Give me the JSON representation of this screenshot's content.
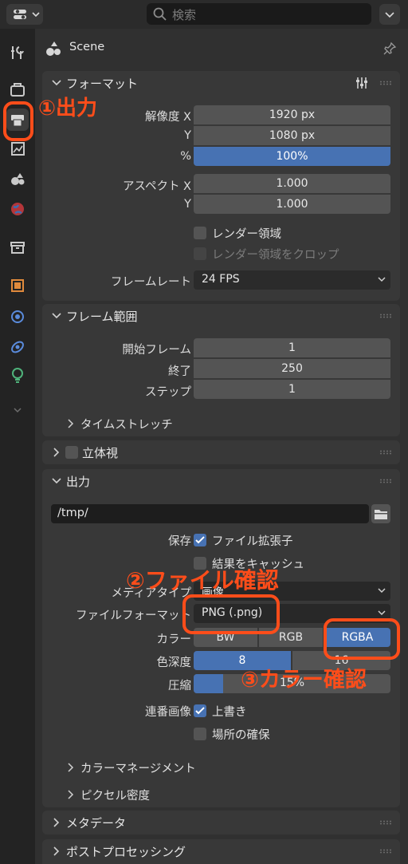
{
  "topbar": {
    "search_placeholder": "検索"
  },
  "scene": {
    "label": "Scene"
  },
  "format_panel": {
    "title": "フォーマット",
    "resolution_x_label": "解像度 X",
    "resolution_x": "1920 px",
    "resolution_y_label": "Y",
    "resolution_y": "1080 px",
    "percent_label": "%",
    "percent": "100%",
    "percent_fraction": 1.0,
    "aspect_x_label": "アスペクト X",
    "aspect_x": "1.000",
    "aspect_y_label": "Y",
    "aspect_y": "1.000",
    "render_region": "レンダー領域",
    "crop_region": "レンダー領域をクロップ",
    "framerate_label": "フレームレート",
    "framerate": "24 FPS"
  },
  "frame_range_panel": {
    "title": "フレーム範囲",
    "start_label": "開始フレーム",
    "start": "1",
    "end_label": "終了",
    "end": "250",
    "step_label": "ステップ",
    "step": "1",
    "time_stretch": "タイムストレッチ"
  },
  "stereo_panel": {
    "title": "立体視"
  },
  "output_panel": {
    "title": "出力",
    "path": "/tmp/",
    "save_label": "保存",
    "file_extension": "ファイル拡張子",
    "cache_result": "結果をキャッシュ",
    "media_type_label": "メディアタイプ",
    "media_type": "画像",
    "file_format_label": "ファイルフォーマット",
    "file_format": "PNG (.png)",
    "color_label": "カラー",
    "color_options": [
      "BW",
      "RGB",
      "RGBA"
    ],
    "color_selected": "RGBA",
    "depth_label": "色深度",
    "depth_options": [
      "8",
      "16"
    ],
    "depth_selected": "8",
    "compression_label": "圧縮",
    "compression": "15%",
    "compression_fraction": 0.15,
    "sequence_label": "連番画像",
    "overwrite": "上書き",
    "placeholders": "場所の確保",
    "color_management": "カラーマネージメント",
    "pixel_density": "ピクセル密度"
  },
  "metadata_panel": {
    "title": "メタデータ"
  },
  "postprocessing_panel": {
    "title": "ポストプロセッシング"
  },
  "annotations": {
    "a1": "①出力",
    "a2": "②ファイル確認",
    "a3": "③カラー確認"
  },
  "colors": {
    "accent": "#4772b3",
    "annotation": "#ff4d1a"
  }
}
